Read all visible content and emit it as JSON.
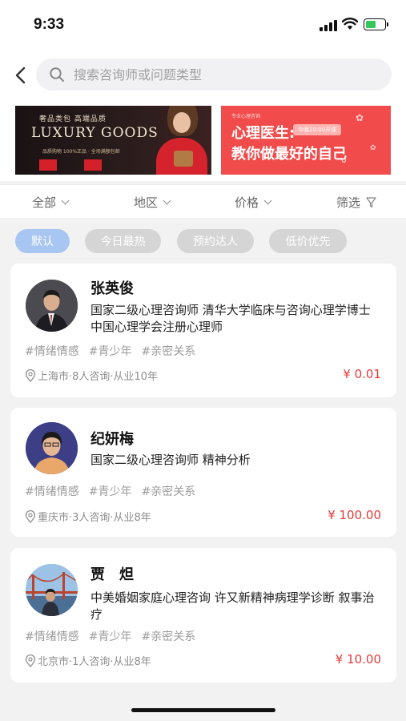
{
  "status_bar": {
    "time": "9:33"
  },
  "search": {
    "placeholder": "搜索咨询师或问题类型"
  },
  "banners": {
    "left": {
      "subtitle": "奢品类包 高端品质",
      "title": "LUXURY GOODS",
      "fine_print": "品质购物 100%正品 · 全场满额包邮"
    },
    "right": {
      "eyebrow": "专业心理咨询",
      "line1": "心理医生:",
      "pill": "今晚20:00开课",
      "line2": "教你做最好的自己"
    }
  },
  "filters": [
    {
      "label": "全部"
    },
    {
      "label": "地区"
    },
    {
      "label": "价格"
    },
    {
      "label": "筛选"
    }
  ],
  "sort_chips": [
    {
      "label": "默认",
      "active": true
    },
    {
      "label": "今日最热",
      "active": false
    },
    {
      "label": "预约达人",
      "active": false
    },
    {
      "label": "低价优先",
      "active": false
    }
  ],
  "counselors": [
    {
      "name": "张英俊",
      "description": "国家二级心理咨询师  清华大学临床与咨询心理学博士  中国心理学会注册心理师",
      "tags": [
        "#情绪情感",
        "#青少年",
        "#亲密关系"
      ],
      "location": "上海市·8人咨询·从业10年",
      "price": "¥ 0.01"
    },
    {
      "name": "纪妍梅",
      "description": "国家二级心理咨询师  精神分析",
      "tags": [
        "#情绪情感",
        "#青少年",
        "#亲密关系"
      ],
      "location": "重庆市·3人咨询·从业8年",
      "price": "¥ 100.00"
    },
    {
      "name": "贾　炟",
      "description": "中美婚姻家庭心理咨询  许又新精神病理学诊断  叙事治疗",
      "tags": [
        "#情绪情感",
        "#青少年",
        "#亲密关系"
      ],
      "location": "北京市·1人咨询·从业8年",
      "price": "¥ 10.00"
    }
  ],
  "colors": {
    "accent_chip": "#a8c6f2",
    "price": "#e23b3b",
    "banner_red": "#f14b4b"
  }
}
